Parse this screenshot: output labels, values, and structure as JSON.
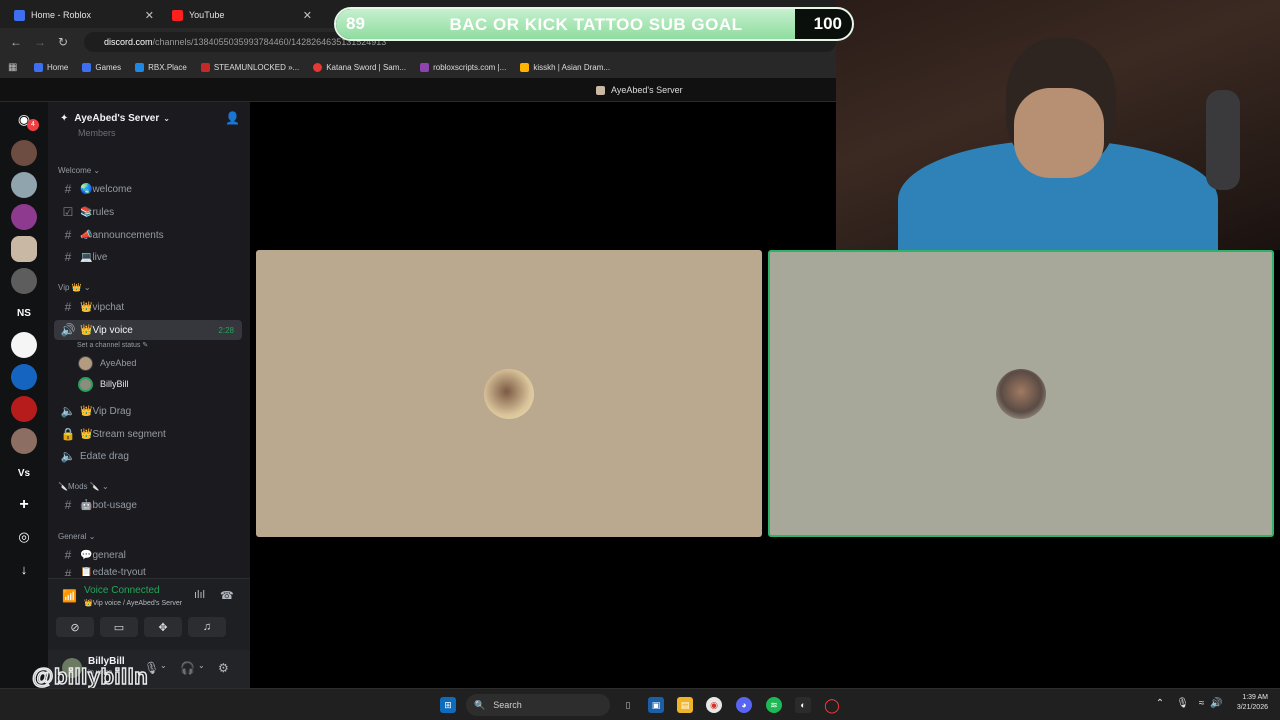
{
  "browser": {
    "tabs": [
      {
        "title": "Home - Roblox",
        "icon": "roblox-icon"
      },
      {
        "title": "YouTube",
        "icon": "youtube-icon"
      }
    ],
    "url_host": "discord.com",
    "url_path": "/channels/1384055035993784460/1428264635131524913",
    "bookmarks": [
      "Home",
      "Games",
      "RBX.Place",
      "STEAMUNLOCKED »...",
      "Katana Sword | Sam...",
      "robloxscripts.com |...",
      "kisskh | Asian Dram..."
    ],
    "page_caption": "AyeAbed's Server"
  },
  "overlay": {
    "goal_start": "89",
    "goal_title": "BAC OR KICK TATTOO SUB GOAL",
    "goal_end": "100",
    "goal_progress": 0.89,
    "watermark": "@billybilln"
  },
  "guilds": {
    "notification_count": "4",
    "ns_label": "NS",
    "vs_label": "Vs"
  },
  "server": {
    "name": "AyeAbed's Server",
    "clipped_item": "Members",
    "categories": {
      "welcome": "Welcome",
      "vip": "Vip 👑",
      "mods": "🔪Mods 🔪",
      "general": "General"
    },
    "channels": {
      "welcome": "🌏welcome",
      "rules": "📚rules",
      "announcements": "📣announcements",
      "live": "💻live",
      "vipchat": "👑vipchat",
      "vipvoice": "👑Vip voice",
      "vipvoice_time": "2:28",
      "vipvoice_status": "Set a channel status ✎",
      "vipdrag": "👑Vip Drag",
      "streamsegment": "👑Stream segment",
      "edatedrag": "Edate drag",
      "botusage": "🤖bot-usage",
      "general": "💬general",
      "clipped": "📋edate-tryout"
    },
    "voice_users": [
      "AyeAbed",
      "BillyBill"
    ]
  },
  "voice_panel": {
    "title": "Voice Connected",
    "subtitle": "👑Vip voice / AyeAbed's Server"
  },
  "user_panel": {
    "name": "BillyBill",
    "status": "In voice"
  },
  "taskbar": {
    "search_placeholder": "Search",
    "time": "1:39 AM",
    "date": "3/21/2026"
  },
  "colors": {
    "discord_bg": "#1b1b1f",
    "voice_green": "#23a559",
    "tile1": "#baa98f",
    "tile2": "#a8a89a",
    "goal_fill": "#8fdc9f"
  }
}
